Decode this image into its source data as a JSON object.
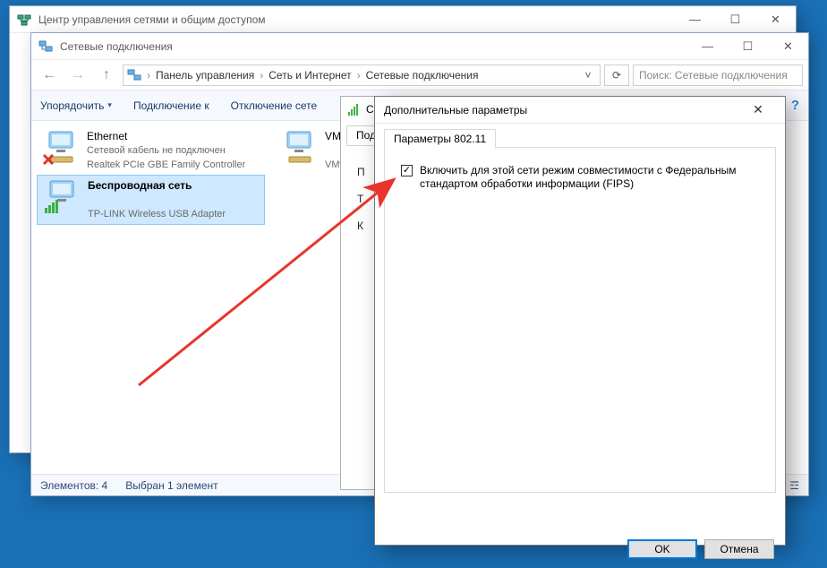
{
  "window_bg": {
    "title": "Центр управления сетями и общим доступом"
  },
  "window_main": {
    "title": "Сетевые подключения",
    "breadcrumbs": {
      "root": "Панель управления",
      "mid": "Сеть и Интернет",
      "leaf": "Сетевые подключения"
    },
    "search_placeholder": "Поиск: Сетевые подключения",
    "toolbar": {
      "organize": "Упорядочить",
      "connect": "Подключение к",
      "disable": "Отключение сете"
    },
    "adapters": {
      "ethernet": {
        "name": "Ethernet",
        "status": "Сетевой кабель не подключен",
        "device": "Realtek PCIe GBE Family Controller"
      },
      "wifi": {
        "name": "Беспроводная сеть",
        "status": "",
        "device": "TP-LINK Wireless USB Adapter"
      },
      "vmw": {
        "name": "VMw",
        "status": "",
        "device": "VMw"
      }
    },
    "statusbar": {
      "items": "Элементов: 4",
      "selected": "Выбран 1 элемент"
    }
  },
  "prop_peek": {
    "title_prefix": "Сво",
    "tab": "Под",
    "lines": {
      "a": "П",
      "b": "Т",
      "c": "К"
    }
  },
  "advanced": {
    "title": "Дополнительные параметры",
    "tab": "Параметры 802.11",
    "checkbox_label": "Включить для этой сети режим совместимости с Федеральным стандартом обработки информации (FIPS)",
    "checked": true,
    "ok": "OK",
    "cancel": "Отмена"
  }
}
